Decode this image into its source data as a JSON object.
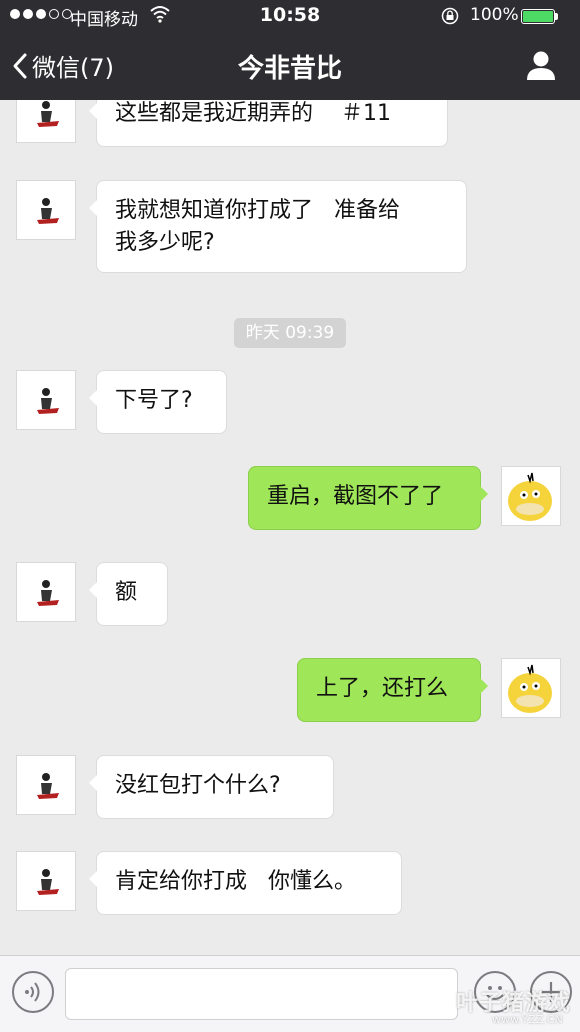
{
  "status_bar": {
    "carrier": "中国移动",
    "time": "10:58",
    "battery": "100%",
    "battery_color": "#4cd964"
  },
  "nav": {
    "back_label": "微信(7)",
    "title": "今非昔比",
    "right_icon": "person-icon"
  },
  "messages": [
    {
      "from": "friend",
      "text": "这些都是我近期弄的    ＃11"
    },
    {
      "from": "friend",
      "text": "我就想知道你打成了   准备给\n我多少呢?"
    },
    {
      "type": "timestamp",
      "text": "昨天 09:39"
    },
    {
      "from": "friend",
      "text": "下号了?"
    },
    {
      "from": "me",
      "text": "重启，截图不了了"
    },
    {
      "from": "friend",
      "text": "额"
    },
    {
      "from": "me",
      "text": "上了，还打么"
    },
    {
      "from": "friend",
      "text": "没红包打个什么?"
    },
    {
      "from": "friend",
      "text": "肯定给你打成   你懂么。"
    }
  ],
  "input_bar": {
    "left_icon": "voice-icon",
    "emoji_icon": "emoji-icon",
    "plus_icon": "plus-icon",
    "value": ""
  },
  "watermark": {
    "text": "叶子猪游戏",
    "url": "www.YZZ.CN"
  },
  "colors": {
    "header_bg": "#2e2e32",
    "chat_bg": "#ebebeb",
    "my_bubble": "#9fe658",
    "friend_bubble": "#ffffff"
  }
}
